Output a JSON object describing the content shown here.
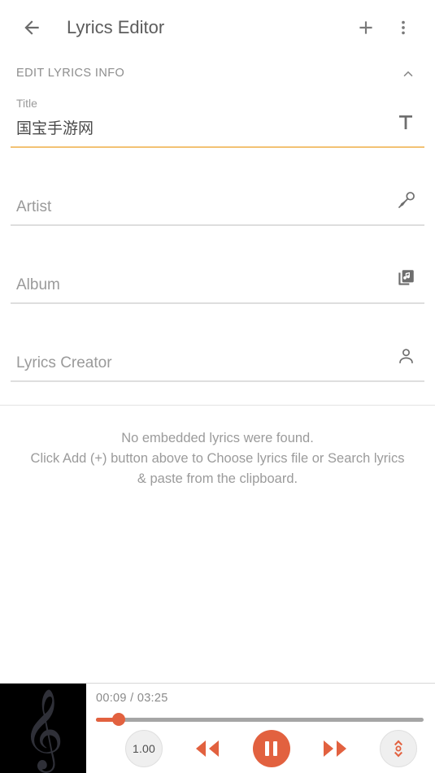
{
  "appbar": {
    "back_icon": "arrow-back-icon",
    "title": "Lyrics Editor",
    "add_icon": "plus-icon",
    "overflow_icon": "more-vert-icon"
  },
  "section": {
    "label": "EDIT LYRICS INFO",
    "collapse_icon": "chevron-up-icon"
  },
  "fields": {
    "title": {
      "label": "Title",
      "value": "国宝手游网",
      "icon": "text-format-icon",
      "focused": true
    },
    "artist": {
      "placeholder": "Artist",
      "value": "",
      "icon": "microphone-icon",
      "focused": false
    },
    "album": {
      "placeholder": "Album",
      "value": "",
      "icon": "library-music-icon",
      "focused": false
    },
    "lyrics_creator": {
      "placeholder": "Lyrics Creator",
      "value": "",
      "icon": "person-icon",
      "focused": false
    }
  },
  "lyrics_area": {
    "empty_line_1": "No embedded lyrics were found.",
    "empty_line_2": "Click Add (+) button above to Choose lyrics file or Search lyrics",
    "empty_line_3": "& paste from the clipboard."
  },
  "player": {
    "album_art_glyph": "𝄞",
    "current_time": "00:09",
    "time_separator": "/",
    "total_time": "03:25",
    "progress_percent": 7,
    "speed_label": "1.00",
    "rewind_icon": "rewind-icon",
    "play_state_icon": "pause-icon",
    "forward_icon": "fast-forward-icon",
    "offset_icon": "offset-adjust-icon"
  },
  "colors": {
    "accent": "#e2613f",
    "focus_underline": "#f3c274",
    "underline": "#dedede",
    "text_primary": "#4a4a4a",
    "text_secondary": "#9a9a9a",
    "album_art_bg": "#000000"
  }
}
